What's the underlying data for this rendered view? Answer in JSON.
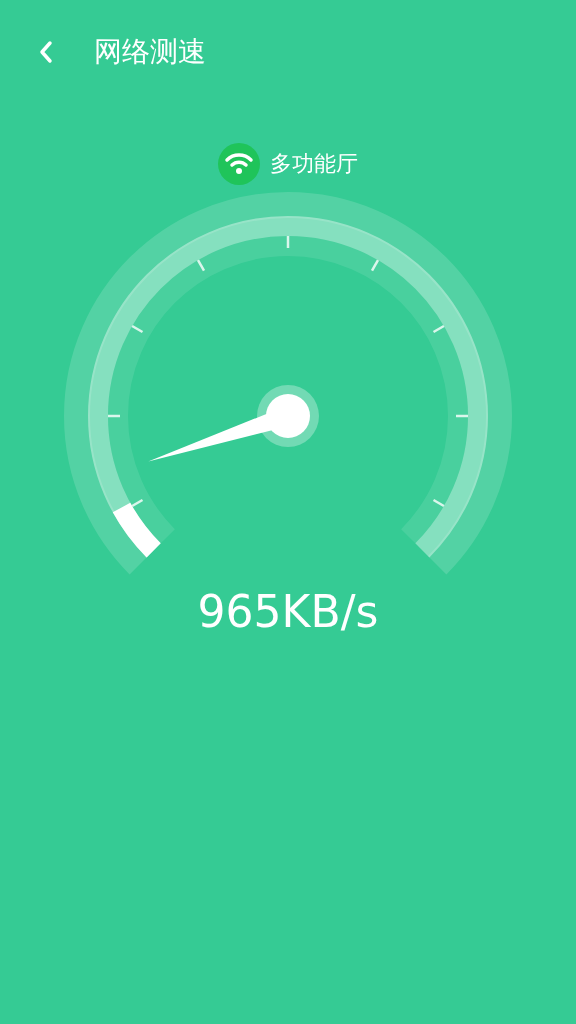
{
  "header": {
    "title": "网络测速"
  },
  "network": {
    "name": "多功能厅"
  },
  "speed": "965KB/s"
}
